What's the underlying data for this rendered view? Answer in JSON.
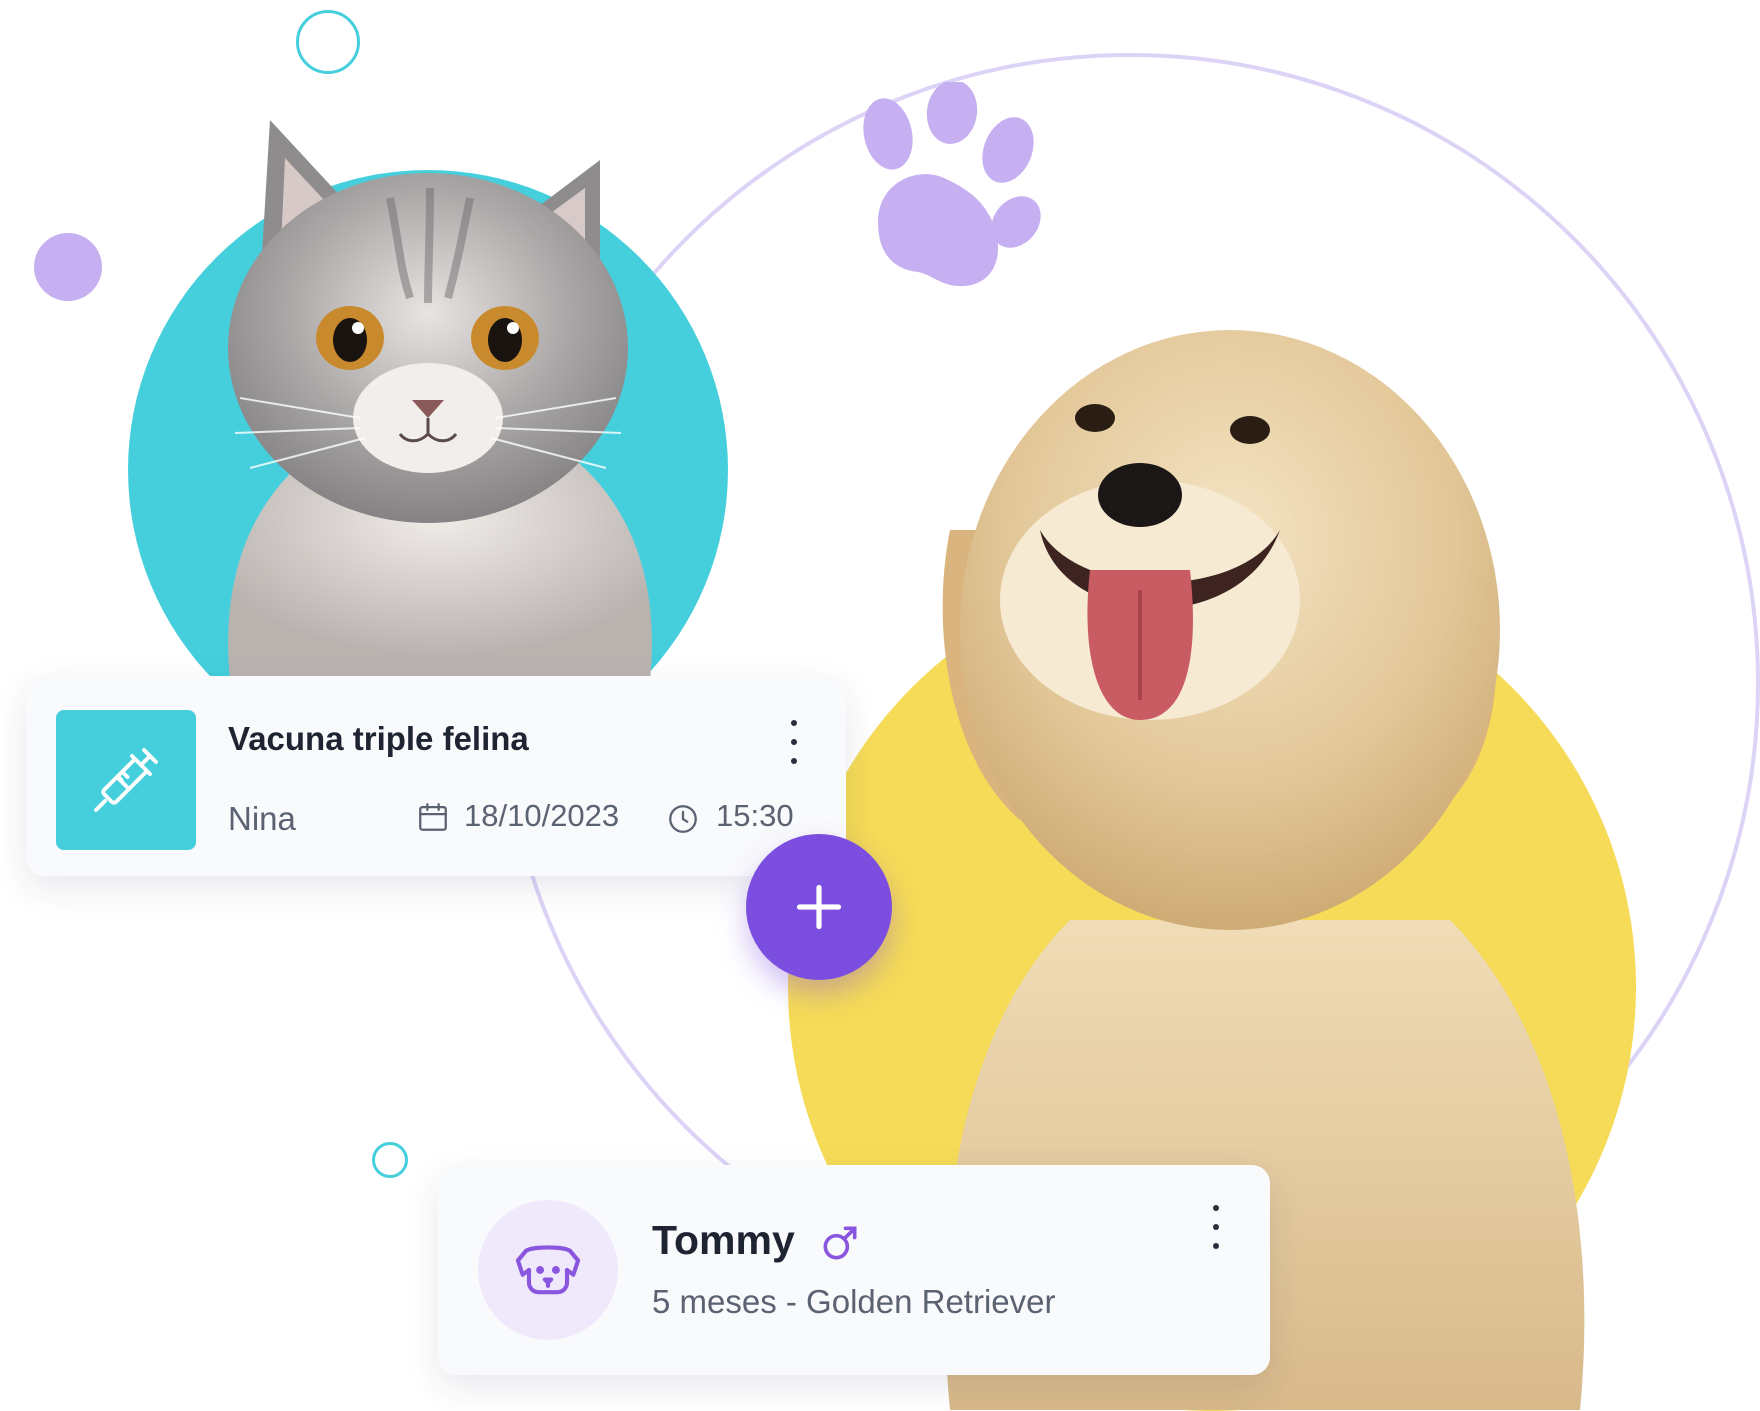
{
  "appointment": {
    "title": "Vacuna triple felina",
    "pet_name": "Nina",
    "date": "18/10/2023",
    "time": "15:30",
    "icon": "syringe-icon",
    "menu_icon": "more-vertical-icon"
  },
  "add_button": {
    "icon": "plus-icon"
  },
  "pet": {
    "name": "Tommy",
    "gender_icon": "male-icon",
    "details": "5 meses - Golden Retriever",
    "avatar_icon": "dog-face-icon",
    "menu_icon": "more-vertical-icon"
  },
  "colors": {
    "teal": "#45cfdc",
    "yellow": "#f5db57",
    "purple": "#7b4ee0",
    "lavender": "#c6b0f1",
    "ring": "#ddd3f6",
    "card_bg": "#f9fafc",
    "text_dark": "#1f2433",
    "text_muted": "#5b6272"
  }
}
